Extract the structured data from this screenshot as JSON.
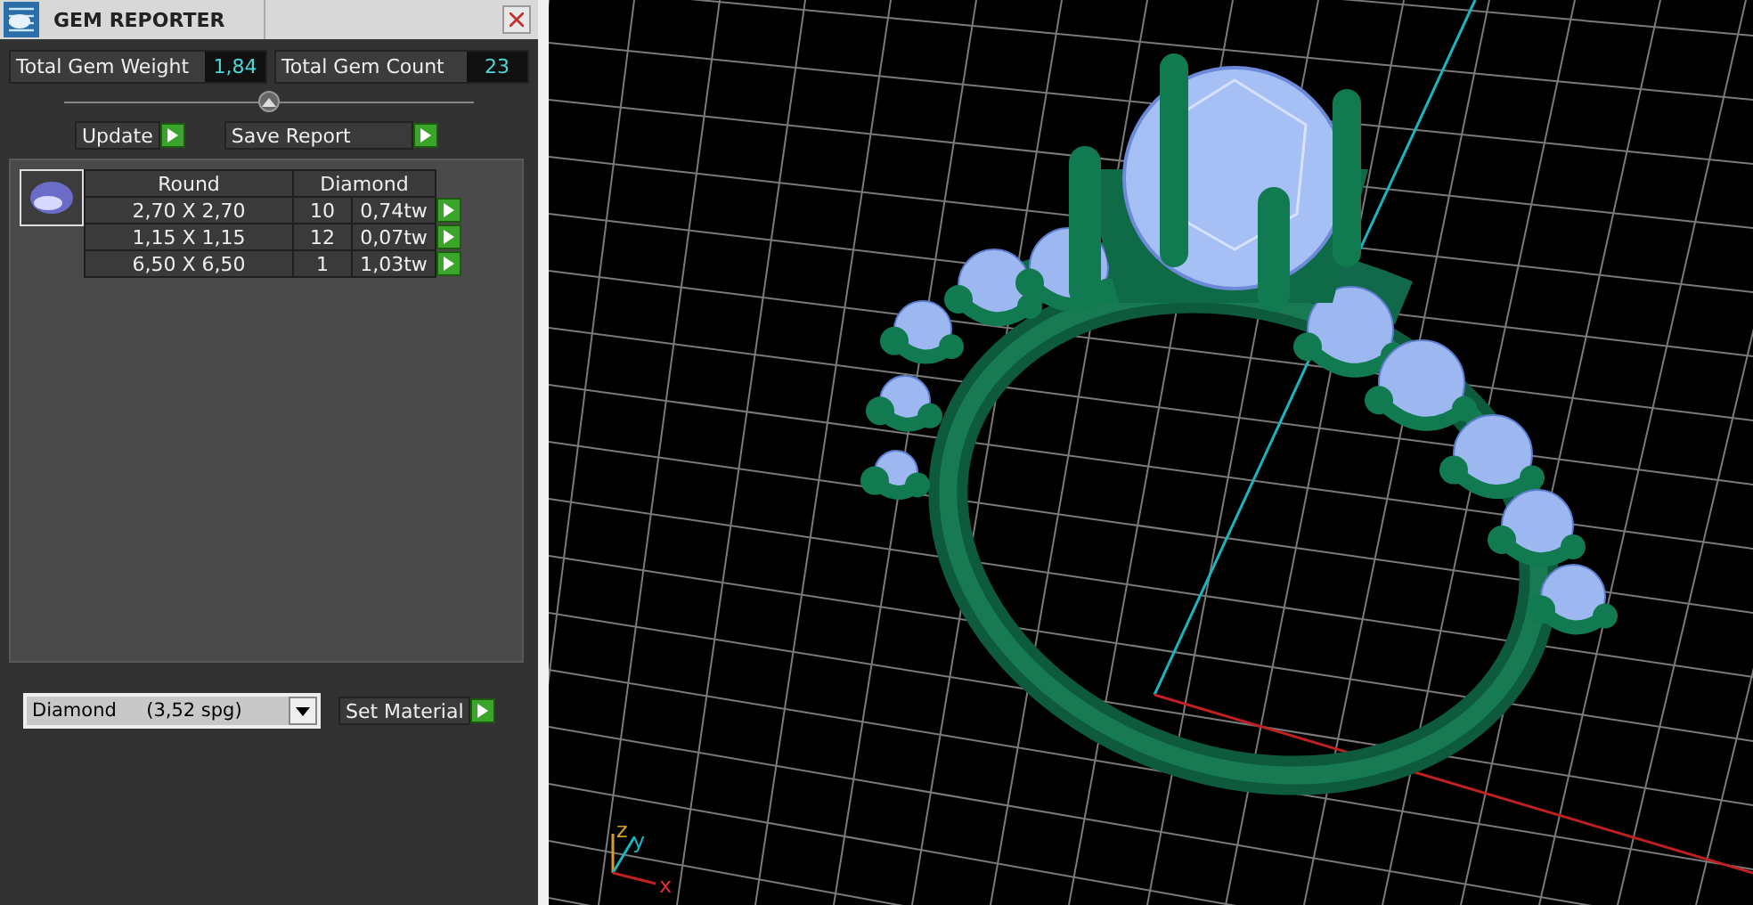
{
  "window": {
    "title": "GEM REPORTER"
  },
  "totals": [
    {
      "label": "Total Gem Weight",
      "value": "1,84"
    },
    {
      "label": "Total Gem Count",
      "value": "23"
    }
  ],
  "actions": [
    "Update",
    "Save Report"
  ],
  "gem_table": {
    "columns": [
      "Round",
      "Diamond"
    ],
    "rows": [
      {
        "size": "2,70 X 2,70",
        "count": "10",
        "weight": "0,74tw"
      },
      {
        "size": "1,15 X 1,15",
        "count": "12",
        "weight": "0,07tw"
      },
      {
        "size": "6,50 X 6,50",
        "count": "1",
        "weight": "1,03tw"
      }
    ]
  },
  "material": {
    "value": "Diamond     (3,52 spg)",
    "button": "Set Material"
  },
  "viewport": {
    "axes": [
      "x",
      "y",
      "z"
    ]
  }
}
